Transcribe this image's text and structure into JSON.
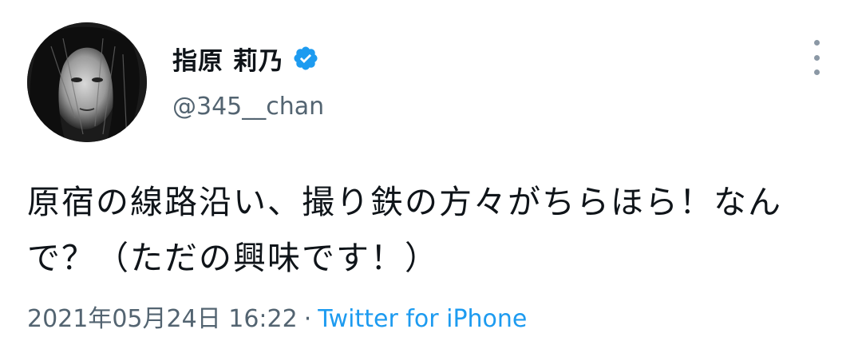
{
  "user": {
    "display_name": "指原 莉乃",
    "handle": "@345__chan",
    "verified": true,
    "verified_icon": "verified-badge-icon"
  },
  "tweet": {
    "text": "原宿の線路沿い、撮り鉄の方々がちらほら！なんで？（ただの興味です！）",
    "timestamp": "2021年05月24日 16:22",
    "separator": "·",
    "source": "Twitter for iPhone"
  },
  "menu": {
    "icon": "more-vertical-icon"
  },
  "colors": {
    "text": "#0f1419",
    "secondary": "#536471",
    "link": "#1d9bf0",
    "verified": "#1d9bf0"
  }
}
